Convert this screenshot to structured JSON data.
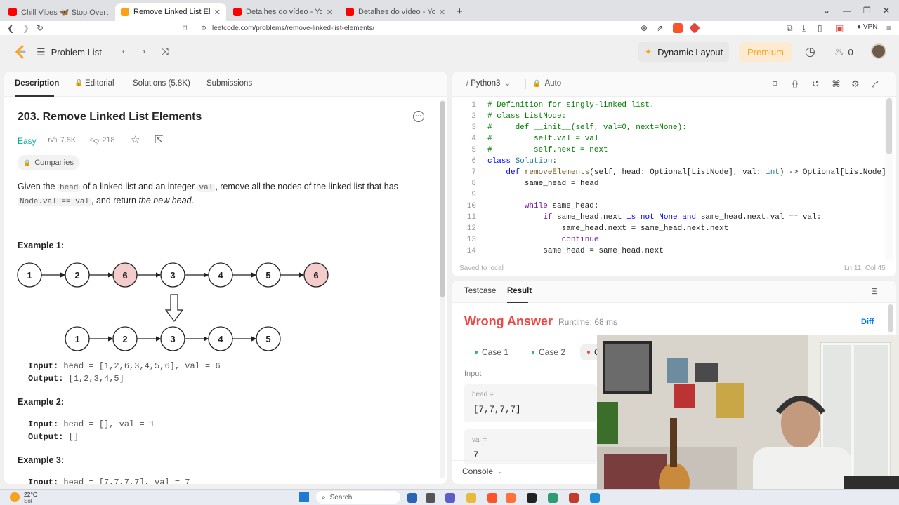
{
  "browser": {
    "tabs": [
      {
        "label": "Chill Vibes 🦋 Stop Overthinking",
        "favicon_color": "#ff0000"
      },
      {
        "label": "Remove Linked List Elements - Le",
        "favicon_color": "#ffa116"
      },
      {
        "label": "Detalhes do vídeo - YouTube Studio",
        "favicon_color": "#ff0000"
      },
      {
        "label": "Detalhes do vídeo - YouTube Studio",
        "favicon_color": "#ff0000"
      }
    ],
    "url": "leetcode.com/problems/remove-linked-list-elements/",
    "vpn_label": "VPN"
  },
  "header": {
    "problem_list": "Problem List",
    "dynamic_layout": "Dynamic Layout",
    "premium": "Premium",
    "streak_count": "0"
  },
  "left": {
    "tabs": [
      "Description",
      "Editorial",
      "Solutions (5.8K)",
      "Submissions"
    ],
    "title": "203. Remove Linked List Elements",
    "difficulty": "Easy",
    "likes": "7.8K",
    "dislikes": "218",
    "companies": "Companies",
    "desc": {
      "p1": "Given the",
      "c1": "head",
      "p2": "of a linked list and an integer",
      "c2": "val",
      "p3": ", remove all the nodes of the linked list that has",
      "c3": "Node.val == val",
      "p4": ", and return",
      "p5": "the new head",
      "p6": "."
    },
    "example1_title": "Example 1:",
    "example1_list_before": [
      "1",
      "2",
      "6",
      "3",
      "4",
      "5",
      "6"
    ],
    "example1_list_after": [
      "1",
      "2",
      "3",
      "4",
      "5"
    ],
    "example1_input_label": "Input:",
    "example1_input": "head = [1,2,6,3,4,5,6], val = 6",
    "example1_output_label": "Output:",
    "example1_output": "[1,2,3,4,5]",
    "example2_title": "Example 2:",
    "example2_input_label": "Input:",
    "example2_input": "head = [], val = 1",
    "example2_output_label": "Output:",
    "example2_output": "[]",
    "example3_title": "Example 3:",
    "example3_input_label": "Input:",
    "example3_input": "head = [7,7,7,7], val = 7"
  },
  "editor": {
    "language": "Python3",
    "mode": "Auto",
    "status_saved": "Saved to local",
    "cursor_pos": "Ln 11, Col 45",
    "line_numbers": [
      "1",
      "2",
      "3",
      "4",
      "5",
      "6",
      "7",
      "8",
      "9",
      "10",
      "11",
      "12",
      "13",
      "14"
    ]
  },
  "result": {
    "tabs": [
      "Testcase",
      "Result"
    ],
    "verdict": "Wrong Answer",
    "runtime": "Runtime: 68 ms",
    "diff": "Diff",
    "cases": [
      "Case 1",
      "Case 2",
      "C"
    ],
    "input_label": "Input",
    "head_label": "head =",
    "head_value": "[7,7,7,7]",
    "val_label": "val =",
    "val_value": "7",
    "console": "Console"
  },
  "taskbar": {
    "temp": "22°C",
    "weather": "Sol",
    "search": "Search"
  }
}
